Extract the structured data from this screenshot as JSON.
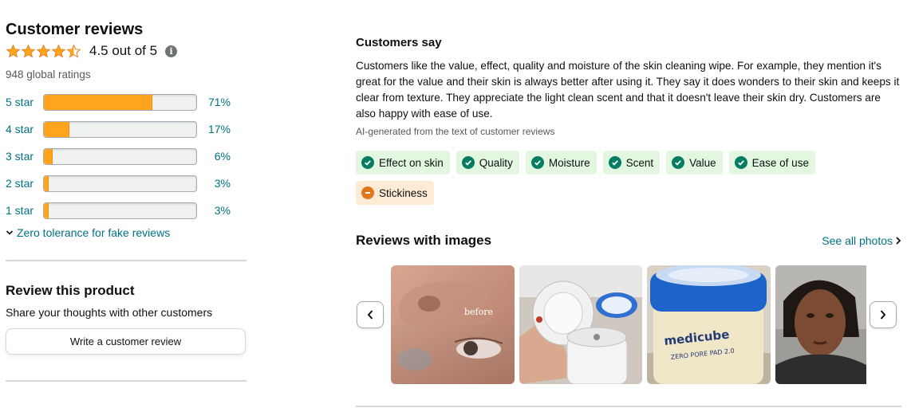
{
  "reviews": {
    "title": "Customer reviews",
    "average_text": "4.5 out of 5",
    "average_value": 4.5,
    "star_color": "#ffa41c",
    "global_ratings": "948 global ratings",
    "histogram": [
      {
        "label": "5 star",
        "percent_text": "71%",
        "percent": 71
      },
      {
        "label": "4 star",
        "percent_text": "17%",
        "percent": 17
      },
      {
        "label": "3 star",
        "percent_text": "6%",
        "percent": 6
      },
      {
        "label": "2 star",
        "percent_text": "3%",
        "percent": 3
      },
      {
        "label": "1 star",
        "percent_text": "3%",
        "percent": 3
      }
    ],
    "zero_tolerance_link": "Zero tolerance for fake reviews"
  },
  "review_product": {
    "title": "Review this product",
    "subtitle": "Share your thoughts with other customers",
    "button_label": "Write a customer review"
  },
  "customers_say": {
    "title": "Customers say",
    "summary": "Customers like the value, effect, quality and moisture of the skin cleaning wipe. For example, they mention it's great for the value and their skin is always better after using it. They say it does wonders to their skin and keeps it clear from texture. They appreciate the light clean scent and that it doesn't leave their skin dry. Customers are also happy with ease of use.",
    "ai_note": "AI-generated from the text of customer reviews",
    "aspects": [
      {
        "label": "Effect on skin",
        "sentiment": "positive",
        "icon": "check-circle-icon"
      },
      {
        "label": "Quality",
        "sentiment": "positive",
        "icon": "check-circle-icon"
      },
      {
        "label": "Moisture",
        "sentiment": "positive",
        "icon": "check-circle-icon"
      },
      {
        "label": "Scent",
        "sentiment": "positive",
        "icon": "check-circle-icon"
      },
      {
        "label": "Value",
        "sentiment": "positive",
        "icon": "check-circle-icon"
      },
      {
        "label": "Ease of use",
        "sentiment": "positive",
        "icon": "check-circle-icon"
      },
      {
        "label": "Stickiness",
        "sentiment": "negative",
        "icon": "minus-circle-icon"
      }
    ],
    "positive_color": "#067d62",
    "negative_color": "#e0761c"
  },
  "images_section": {
    "title": "Reviews with images",
    "see_all": "See all photos",
    "photos": [
      {
        "name": "review-photo-skin-closeup",
        "overlay_text": "before"
      },
      {
        "name": "review-photo-opened-container"
      },
      {
        "name": "review-photo-medicube-jar",
        "brand_text": "medicube",
        "product_text": "ZERO PORE PAD 2.0"
      },
      {
        "name": "review-photo-face-selfie"
      }
    ]
  }
}
